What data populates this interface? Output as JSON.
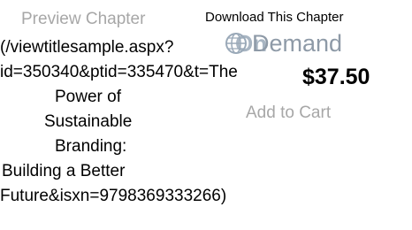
{
  "preview": {
    "label": "Preview Chapter",
    "url_lines": [
      "(/viewtitlesample.aspx?",
      "id=350340&ptid=335470&t=The",
      "Power of",
      "Sustainable",
      "Branding:",
      "Building a Better",
      "Future&isxn=9798369333266)"
    ]
  },
  "download": {
    "label": "Download This Chapter",
    "brand_on": "On",
    "brand_demand": "Demand",
    "brand_icon": "globe-icon",
    "price": "$37.50",
    "add_to_cart": "Add to Cart"
  },
  "colors": {
    "muted_text": "#a7a7a7",
    "brand_gray": "#8e9aa7"
  }
}
